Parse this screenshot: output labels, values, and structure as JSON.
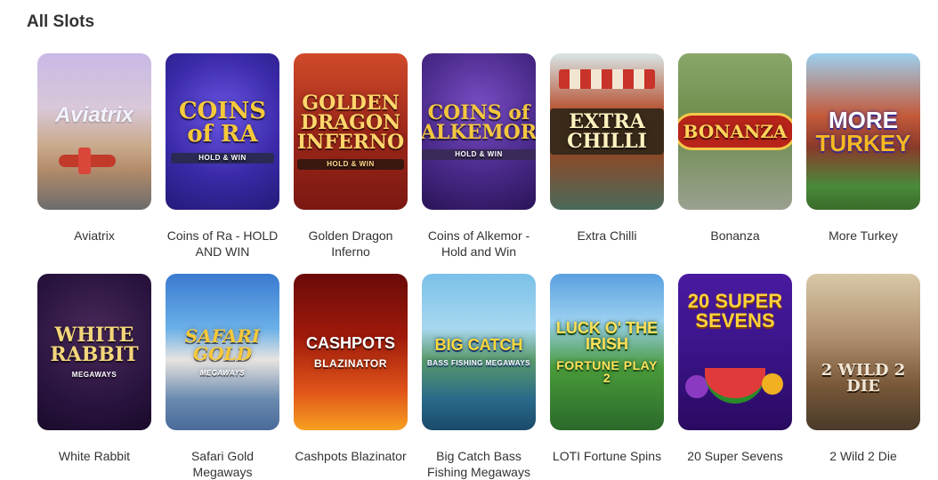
{
  "section_title": "All Slots",
  "games": [
    {
      "key": "aviatrix",
      "caption": "Aviatrix",
      "art_title": "Aviatrix",
      "art_sub": ""
    },
    {
      "key": "ra",
      "caption": "Coins of Ra - HOLD AND WIN",
      "art_title": "COINS of RA",
      "art_sub": "HOLD & WIN"
    },
    {
      "key": "dragon",
      "caption": "Golden Dragon Inferno",
      "art_title": "GOLDEN DRAGON INFERNO",
      "art_sub": "HOLD & WIN"
    },
    {
      "key": "alkemor",
      "caption": "Coins of Alkemor - Hold and Win",
      "art_title": "COINS of ALKEMOR",
      "art_sub": "HOLD & WIN"
    },
    {
      "key": "chilli",
      "caption": "Extra Chilli",
      "art_title": "EXTRA CHILLI",
      "art_sub": ""
    },
    {
      "key": "bonanza",
      "caption": "Bonanza",
      "art_title": "BONANZA",
      "art_sub": ""
    },
    {
      "key": "turkey",
      "caption": "More Turkey",
      "art_title": "MORE",
      "art_title2": "TURKEY",
      "art_sub": ""
    },
    {
      "key": "rabbit",
      "caption": "White Rabbit",
      "art_title": "WHITE RABBIT",
      "art_sub": "MEGAWAYS"
    },
    {
      "key": "safari",
      "caption": "Safari Gold Megaways",
      "art_title": "SAFARI GOLD",
      "art_sub": "MEGAWAYS"
    },
    {
      "key": "cashpots",
      "caption": "Cashpots Blazinator",
      "art_title": "CASHPOTS",
      "art_sub": "BLAZINATOR"
    },
    {
      "key": "bigcatch",
      "caption": "Big Catch Bass Fishing Megaways",
      "art_title": "BIG CATCH",
      "art_sub": "BASS FISHING MEGAWAYS"
    },
    {
      "key": "loti",
      "caption": "LOTI Fortune Spins",
      "art_title": "LUCK O' THE IRISH",
      "art_sub": "FORTUNE PLAY 2"
    },
    {
      "key": "sevens",
      "caption": "20 Super Sevens",
      "art_title": "20 SUPER SEVENS",
      "art_sub": ""
    },
    {
      "key": "wild",
      "caption": "2 Wild 2 Die",
      "art_title": "2 WILD 2 DIE",
      "art_sub": ""
    }
  ]
}
